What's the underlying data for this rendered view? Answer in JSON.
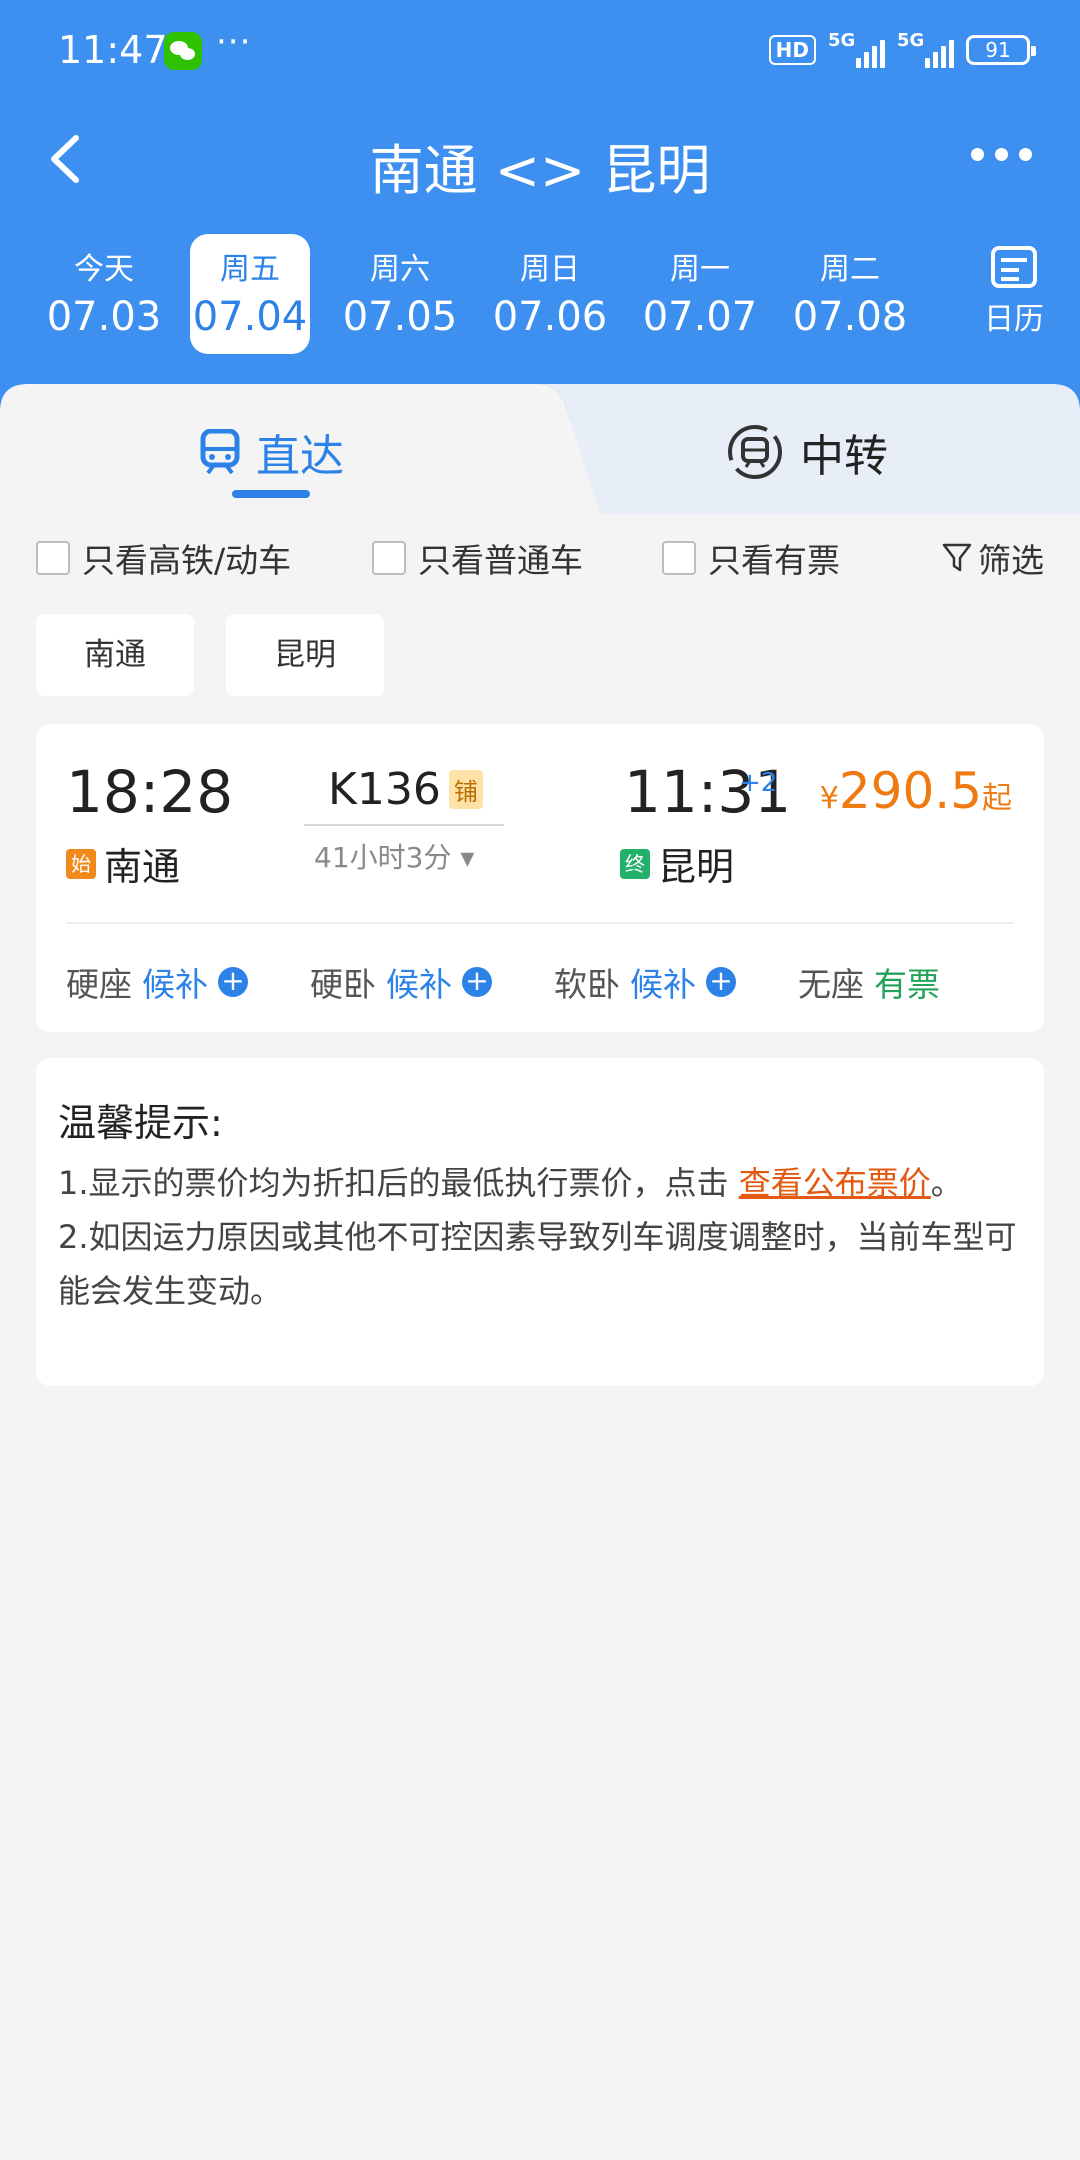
{
  "status_bar": {
    "time": "11:47",
    "more": "···",
    "hd": "HD",
    "net1": "5G",
    "net2": "5G",
    "battery": "91"
  },
  "nav": {
    "title": "南通 <> 昆明"
  },
  "dates": [
    {
      "weekday": "今天",
      "date": "07.03"
    },
    {
      "weekday": "周五",
      "date": "07.04",
      "active": true
    },
    {
      "weekday": "周六",
      "date": "07.05"
    },
    {
      "weekday": "周日",
      "date": "07.06"
    },
    {
      "weekday": "周一",
      "date": "07.07"
    },
    {
      "weekday": "周二",
      "date": "07.08"
    }
  ],
  "calendar_label": "日历",
  "tabs": {
    "direct": "直达",
    "transfer": "中转"
  },
  "filters": {
    "high_speed": "只看高铁/动车",
    "normal": "只看普通车",
    "available": "只看有票",
    "screen": "筛选"
  },
  "chips": [
    "南通",
    "昆明"
  ],
  "train": {
    "departure_time": "18:28",
    "departure_tag": "始",
    "departure_station": "南通",
    "number": "K136",
    "berth_tag": "铺",
    "duration": "41小时3分 ▾",
    "arrival_time": "11:31",
    "arrival_plus": "+2",
    "arrival_tag": "终",
    "arrival_station": "昆明",
    "price_currency": "¥",
    "price": "290.5",
    "price_suffix": "起",
    "seats": [
      {
        "type": "硬座",
        "status": "候补"
      },
      {
        "type": "硬卧",
        "status": "候补"
      },
      {
        "type": "软卧",
        "status": "候补"
      },
      {
        "type": "无座",
        "status": "有票"
      }
    ]
  },
  "notice": {
    "title": "温馨提示:",
    "line1_prefix": "1.显示的票价均为折扣后的最低执行票价，点击 ",
    "line1_link": "查看公布票价",
    "line1_suffix": "。",
    "line2": "2.如因运力原因或其他不可控因素导致列车调度调整时，当前车型可能会发生变动。"
  },
  "colors": {
    "header_blue": "#3d8ff0",
    "accent_blue": "#2d82e8",
    "price_orange": "#ef7a12",
    "green": "#23a35a"
  }
}
